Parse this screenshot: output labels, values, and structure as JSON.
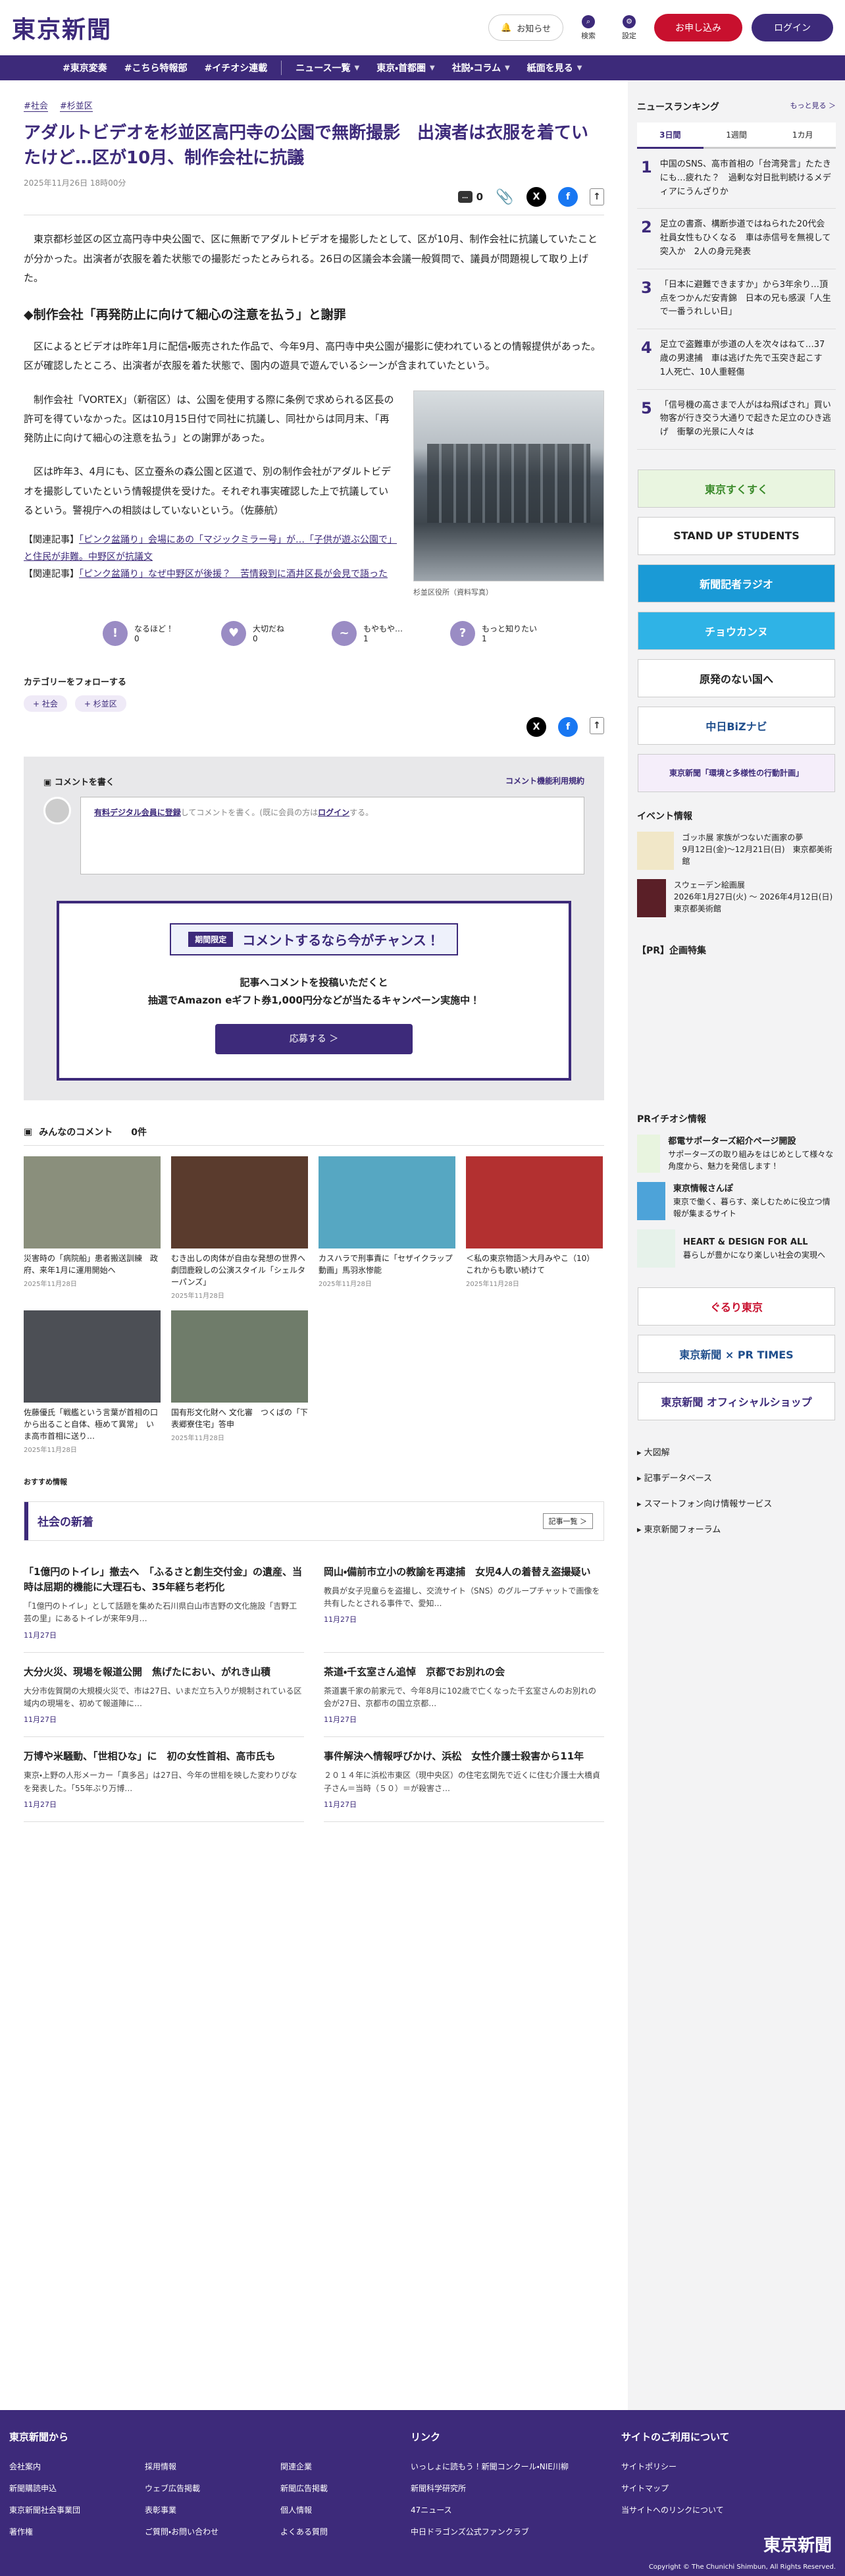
{
  "header": {
    "logo": "東京新聞",
    "notice": "お知らせ",
    "search": "検索",
    "settings": "設定",
    "apply": "お申し込み",
    "login": "ログイン"
  },
  "nav": [
    "#東京変奏",
    "#こちら特報部",
    "#イチオシ連載",
    "ニュース一覧",
    "東京・首都圏",
    "社説・コラム",
    "紙面を見る"
  ],
  "article": {
    "tags": [
      "#社会",
      "#杉並区"
    ],
    "title": "アダルトビデオを杉並区高円寺の公園で無断撮影　出演者は衣服を着ていたけど…区が10月、制作会社に抗議",
    "date": "2025年11月26日 18時00分",
    "comment_count": "0",
    "p1": "東京都杉並区の区立高円寺中央公園で、区に無断でアダルトビデオを撮影したとして、区が10月、制作会社に抗議していたことが分かった。出演者が衣服を着た状態での撮影だったとみられる。26日の区議会本会議一般質問で、議員が問題視して取り上げた。",
    "h2": "◆制作会社「再発防止に向けて細心の注意を払う」と謝罪",
    "p2": "区によるとビデオは昨年1月に配信・販売された作品で、今年9月、高円寺中央公園が撮影に使われているとの情報提供があった。区が確認したところ、出演者が衣服を着た状態で、園内の遊具で遊んでいるシーンが含まれていたという。",
    "p3": "制作会社「VORTEX」（新宿区）は、公園を使用する際に条例で求められる区長の許可を得ていなかった。区は10月15日付で同社に抗議し、同社からは同月末、「再発防止に向けて細心の注意を払う」との謝罪があった。",
    "p4": "区は昨年3、4月にも、区立蚕糸の森公園と区道で、別の制作会社がアダルトビデオを撮影していたという情報提供を受けた。それぞれ事実確認した上で抗議しているという。警視庁への相談はしていないという。（佐藤航）",
    "caption": "杉並区役所（資料写真）",
    "rel_prefix": "【関連記事】",
    "rel1": "「ピンク盆踊り」会場にあの「マジックミラー号」が…「子供が遊ぶ公園で」と住民が非難。中野区が抗議文",
    "rel2": "「ピンク盆踊り」なぜ中野区が後援？　苦情殺到に酒井区長が会見で語った"
  },
  "reactions": [
    {
      "label": "なるほど！",
      "count": "0",
      "glyph": "!"
    },
    {
      "label": "大切だね",
      "count": "0",
      "glyph": "♥"
    },
    {
      "label": "もやもや…",
      "count": "1",
      "glyph": "~"
    },
    {
      "label": "もっと知りたい",
      "count": "1",
      "glyph": "?"
    }
  ],
  "follow": {
    "label": "カテゴリーをフォローする",
    "tags": [
      "社会",
      "杉並区"
    ]
  },
  "comments": {
    "write": "コメントを書く",
    "rules": "コメント機能利用規約",
    "placeholder_link": "有料デジタル会員に登録",
    "placeholder_mid": "してコメントを書く。(既に会員の方は",
    "placeholder_login": "ログイン",
    "placeholder_end": "する。",
    "promo_limit": "期間限定",
    "promo_title": "コメントするなら今がチャンス！",
    "promo_l1": "記事へコメントを投稿いただくと",
    "promo_l2": "抽選でAmazon eギフト券1,000円分などが当たるキャンペーン実施中！",
    "promo_btn": "応募する ＞",
    "all": "みんなのコメント",
    "all_count": "0件"
  },
  "photos": [
    {
      "t": "災害時の「病院船」患者搬送訓練　政府、来年1月に運用開始へ",
      "d": "2025年11月28日",
      "c": "#8a8f7c"
    },
    {
      "t": "むき出しの肉体が自由な発想の世界へ　劇団鹿殺しの公演スタイル「シェルターパンズ」",
      "d": "2025年11月28日",
      "c": "#5a3b2d"
    },
    {
      "t": "カスハラで刑事責に「セザイクラップ動画」馬羽氷惨能",
      "d": "2025年11月28日",
      "c": "#56a7c2"
    },
    {
      "t": "＜私の東京物語＞大月みやこ（10）　これからも歌い続けて",
      "d": "2025年11月28日",
      "c": "#b33030"
    },
    {
      "t": "佐藤優氏「戦艦という言葉が首相の口から出ること自体、極めて異常」　いま高市首相に送り…",
      "d": "2025年11月28日",
      "c": "#4c4f55"
    },
    {
      "t": "国有形文化財へ 文化審　つくばの「下表郷寮住宅」答申",
      "d": "2025年11月28日",
      "c": "#6f7c6a"
    }
  ],
  "recommend": "おすすめ情報",
  "shakai": {
    "head": "社会の新着",
    "more": "記事一覧 ＞",
    "items": [
      {
        "h": "「1億円のトイレ」撤去へ　「ふるさと創生交付金」の遺産、当時は屈期的機能に大理石も、35年経ち老朽化",
        "s": "「1億円のトイレ」として話題を集めた石川県白山市吉野の文化施設「吉野工芸の里」にあるトイレが来年9月…",
        "d": "11月27日"
      },
      {
        "h": "岡山・備前市立小の教諭を再逮捕　女児4人の着替え盗撮疑い",
        "s": "教員が女子児童らを盗撮し、交流サイト（SNS）のグループチャットで画像を共有したとされる事件で、愛知…",
        "d": "11月27日"
      },
      {
        "h": "大分火災、現場を報道公開　焦げたにおい、がれき山積",
        "s": "大分市佐賀関の大規模火災で、市は27日、いまだ立ち入りが規制されている区域内の現場を、初めて報道陣に…",
        "d": "11月27日"
      },
      {
        "h": "茶道・千玄室さん追悼　京都でお別れの会",
        "s": "茶道裏千家の前家元で、今年8月に102歳で亡くなった千玄室さんのお別れの会が27日、京都市の国立京都…",
        "d": "11月27日"
      },
      {
        "h": "万博や米騒動、「世相ひな」に　初の女性首相、高市氏も",
        "s": "東京・上野の人形メーカー「真多呂」は27日、今年の世相を映した変わりびなを発表した。「55年ぶり万博…",
        "d": "11月27日"
      },
      {
        "h": "事件解決へ情報呼びかけ、浜松　女性介護士殺害から11年",
        "s": "２０１４年に浜松市東区（現中央区）の住宅玄関先で近くに住む介護士大橋貞子さん＝当時（５０）＝が殺害さ…",
        "d": "11月27日"
      }
    ]
  },
  "side": {
    "ranking": "ニュースランキング",
    "more": "もっと見る ＞",
    "tabs": [
      "3日間",
      "1週間",
      "1カ月"
    ],
    "ranks": [
      {
        "no": "1",
        "t": "中国のSNS、高市首相の「台湾発言」たたきにも…疲れた？　過剰な対日批判続けるメディアにうんざりか"
      },
      {
        "no": "2",
        "t": "足立の書斎、構断歩道ではねられた20代会社員女性もひくなる　車は赤信号を無視して突入か　2人の身元発表"
      },
      {
        "no": "3",
        "t": "「日本に避難できますか」から3年余り…頂点をつかんだ安青錦　日本の兄も感涙「人生で一番うれしい日」"
      },
      {
        "no": "4",
        "t": "足立で盗難車が歩道の人を次々はねて…37歳の男逮捕　車は逃げた先で玉突き起こす　1人死亡、10人重軽傷"
      },
      {
        "no": "5",
        "t": "「信号機の高さまで人がはね飛ばされ」買い物客が行き交う大通りで起きた足立のひき逃げ　衝撃の光景に人々は"
      }
    ],
    "banners": [
      "東京すくすく",
      "STAND UP STUDENTS",
      "新聞記者ラジオ",
      "チョウカンヌ",
      "原発のない国へ",
      "中日BiZナビ",
      "東京新聞「環境と多様性の行動計画」"
    ],
    "event_head": "イベント情報",
    "events": [
      {
        "t": "ゴッホ展 家族がつないだ画家の夢",
        "s": "9月12日(金)〜12月21日(日)　東京都美術館"
      },
      {
        "t": "スウェーデン絵画展",
        "s": "2026年1月27日(火) 〜 2026年4月12日(日)　東京都美術館"
      }
    ],
    "pr_head": "【PR】企画特集",
    "pr2_head": "PRイチオシ情報",
    "prs": [
      {
        "h": "都電サポーターズ紹介ページ開設",
        "s": "サポーターズの取り組みをはじめとして様々な角度から、魅力を発信します！"
      },
      {
        "h": "東京情報さんぽ",
        "s": "東京で働く、暮らす、楽しむために役立つ情報が集まるサイト"
      },
      {
        "h": "HEART & DESIGN FOR ALL",
        "s": "暮らしが豊かになり楽しい社会の実現へ"
      }
    ],
    "banners2": [
      "ぐるり東京",
      "東京新聞 × PR TIMES",
      "東京新聞 オフィシャルショップ"
    ],
    "links": [
      "大図解",
      "記事データベース",
      "スマートフォン向け情報サービス",
      "東京新聞フォーラム"
    ]
  },
  "footer": {
    "c1": "東京新聞から",
    "c1links": [
      "会社案内",
      "採用情報",
      "関連企業",
      "新聞購読申込",
      "ウェブ広告掲載",
      "新聞広告掲載",
      "東京新聞社会事業団",
      "表彰事業",
      "個人情報",
      "著作権",
      "ご質問・お問い合わせ",
      "よくある質問"
    ],
    "c2": "リンク",
    "c2links": [
      "いっしょに読もう！新聞コンクール・NIE川柳",
      "新聞科学研究所",
      "47ニュース",
      "中日ドラゴンズ公式ファンクラブ"
    ],
    "c3": "サイトのご利用について",
    "c3links": [
      "サイトポリシー",
      "サイトマップ",
      "当サイトへのリンクについて"
    ],
    "logo": "東京新聞",
    "copy": "Copyright © The Chunichi Shimbun, All Rights Reserved."
  }
}
